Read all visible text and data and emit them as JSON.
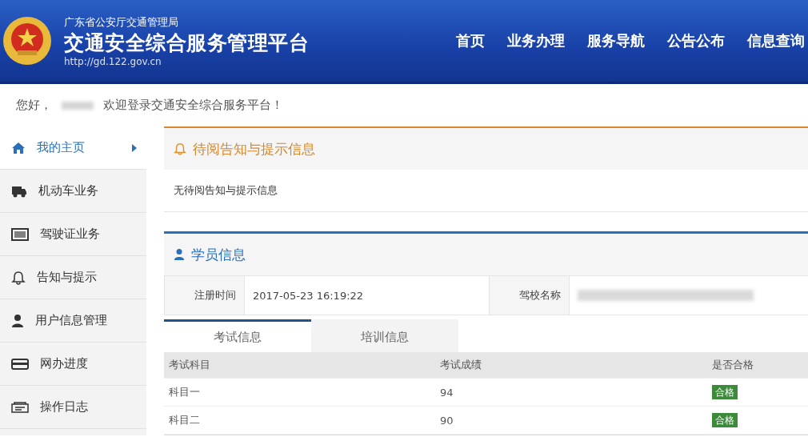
{
  "header": {
    "org": "广东省公安厅交通管理局",
    "title": "交通安全综合服务管理平台",
    "url": "http://gd.122.gov.cn",
    "nav": [
      "首页",
      "业务办理",
      "服务导航",
      "公告公布",
      "信息查询"
    ]
  },
  "greeting": {
    "hello": "您好，",
    "welcome": "欢迎登录交通安全综合服务平台！"
  },
  "sidebar": {
    "items": [
      {
        "label": "我的主页",
        "kind": "home",
        "selected": true
      },
      {
        "label": "机动车业务",
        "kind": "truck",
        "selected": false
      },
      {
        "label": "驾驶证业务",
        "kind": "card",
        "selected": false
      },
      {
        "label": "告知与提示",
        "kind": "bell",
        "selected": false
      },
      {
        "label": "用户信息管理",
        "kind": "user",
        "selected": false
      },
      {
        "label": "网办进度",
        "kind": "wallet",
        "selected": false
      },
      {
        "label": "操作日志",
        "kind": "log",
        "selected": false
      }
    ]
  },
  "notice_panel": {
    "title": "待阅告知与提示信息",
    "body": "无待阅告知与提示信息"
  },
  "student_panel": {
    "title": "学员信息",
    "fields": [
      {
        "label": "注册时间",
        "value": "2017-05-23 16:19:22"
      },
      {
        "label": "驾校名称"
      }
    ],
    "tabs": [
      {
        "label": "考试信息",
        "selected": true
      },
      {
        "label": "培训信息",
        "selected": false
      }
    ],
    "table": {
      "columns": [
        "考试科目",
        "考试成绩",
        "是否合格"
      ],
      "rows": [
        {
          "subject": "科目一",
          "score": "94",
          "result": "合格"
        },
        {
          "subject": "科目二",
          "score": "90",
          "result": "合格"
        }
      ]
    }
  }
}
